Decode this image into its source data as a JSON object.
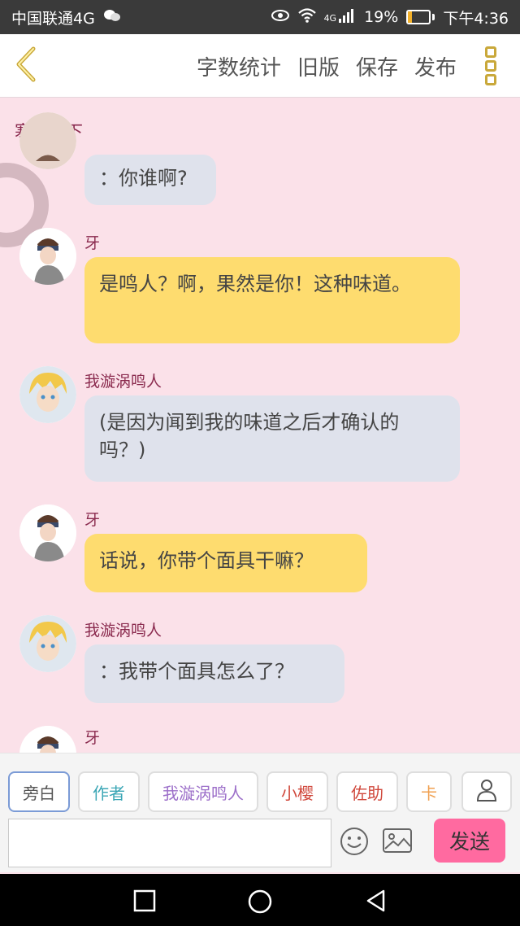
{
  "status_bar": {
    "carrier": "中国联通4G",
    "network": "4G",
    "battery": "19%",
    "battery_level": 0.19,
    "time": "下午4:36",
    "icons": [
      "wechat-icon",
      "eye-icon",
      "wifi-icon",
      "signal-icon",
      "battery-icon"
    ]
  },
  "toolbar": {
    "word_count": "字数统计",
    "old_version": "旧版",
    "save": "保存",
    "publish": "发布"
  },
  "chat": {
    "title": "寒暄一下",
    "messages": [
      {
        "sender": "",
        "text": "：你谁啊?",
        "style": "gray"
      },
      {
        "sender": "牙",
        "text": "是鸣人？啊，果然是你！这种味道。",
        "style": "yellow"
      },
      {
        "sender": "我漩涡鸣人",
        "text": "(是因为闻到我的味道之后才确认的吗？)",
        "style": "gray"
      },
      {
        "sender": "牙",
        "text": "话说，你带个面具干嘛？",
        "style": "yellow"
      },
      {
        "sender": "我漩涡鸣人",
        "text": "：我带个面具怎么了？",
        "style": "gray"
      },
      {
        "sender": "牙",
        "text": "",
        "style": "yellow"
      }
    ]
  },
  "characters": [
    {
      "label": "旁白",
      "color": "#555555"
    },
    {
      "label": "作者",
      "color": "#3aa6b5"
    },
    {
      "label": "我漩涡鸣人",
      "color": "#9c6fc9"
    },
    {
      "label": "小樱",
      "color": "#d0473b"
    },
    {
      "label": "佐助",
      "color": "#d0473b"
    },
    {
      "label": "卡",
      "color": "#f0a050"
    }
  ],
  "input": {
    "value": "",
    "send": "发送"
  },
  "colors": {
    "background": "#fbe1e9",
    "name_color": "#8a2a4e",
    "bubble_gray": "#dfe2ec",
    "bubble_yellow": "#fedc6f",
    "send_button": "#ff6aa0",
    "menu_accent": "#c9a83a"
  }
}
